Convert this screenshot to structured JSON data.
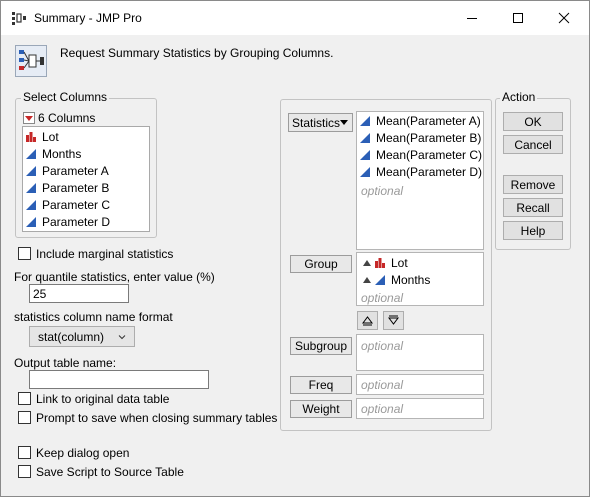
{
  "window": {
    "title": "Summary - JMP Pro",
    "minimize_icon": "minimize-icon",
    "maximize_icon": "maximize-icon",
    "close_icon": "close-icon"
  },
  "header": {
    "description": "Request Summary Statistics by Grouping Columns."
  },
  "select_columns": {
    "title": "Select Columns",
    "count_label": "6 Columns",
    "columns": [
      {
        "name": "Lot",
        "type": "nominal"
      },
      {
        "name": "Months",
        "type": "continuous"
      },
      {
        "name": "Parameter A",
        "type": "continuous"
      },
      {
        "name": "Parameter B",
        "type": "continuous"
      },
      {
        "name": "Parameter C",
        "type": "continuous"
      },
      {
        "name": "Parameter D",
        "type": "continuous"
      }
    ]
  },
  "options": {
    "include_marginal": "Include marginal statistics",
    "quantile_label": "For quantile statistics, enter value (%)",
    "quantile_value": "25",
    "format_label": "statistics column name format",
    "format_value": "stat(column)",
    "output_label": "Output table name:",
    "output_value": "",
    "link_original": "Link to original data table",
    "prompt_save": "Prompt to save when closing summary tables",
    "keep_open": "Keep dialog open",
    "save_script": "Save Script to Source Table"
  },
  "roles": {
    "statistics_button": "Statistics",
    "statistics_items": [
      "Mean(Parameter A)",
      "Mean(Parameter B)",
      "Mean(Parameter C)",
      "Mean(Parameter D)"
    ],
    "group_button": "Group",
    "group_items": [
      "Lot",
      "Months"
    ],
    "subgroup_button": "Subgroup",
    "freq_button": "Freq",
    "weight_button": "Weight",
    "optional_text": "optional"
  },
  "action": {
    "title": "Action",
    "ok": "OK",
    "cancel": "Cancel",
    "remove": "Remove",
    "recall": "Recall",
    "help": "Help"
  },
  "colors": {
    "continuous_icon": "#2b5fb6",
    "nominal_icon": "#c62828",
    "dropdown_arrow": "#c62828"
  }
}
